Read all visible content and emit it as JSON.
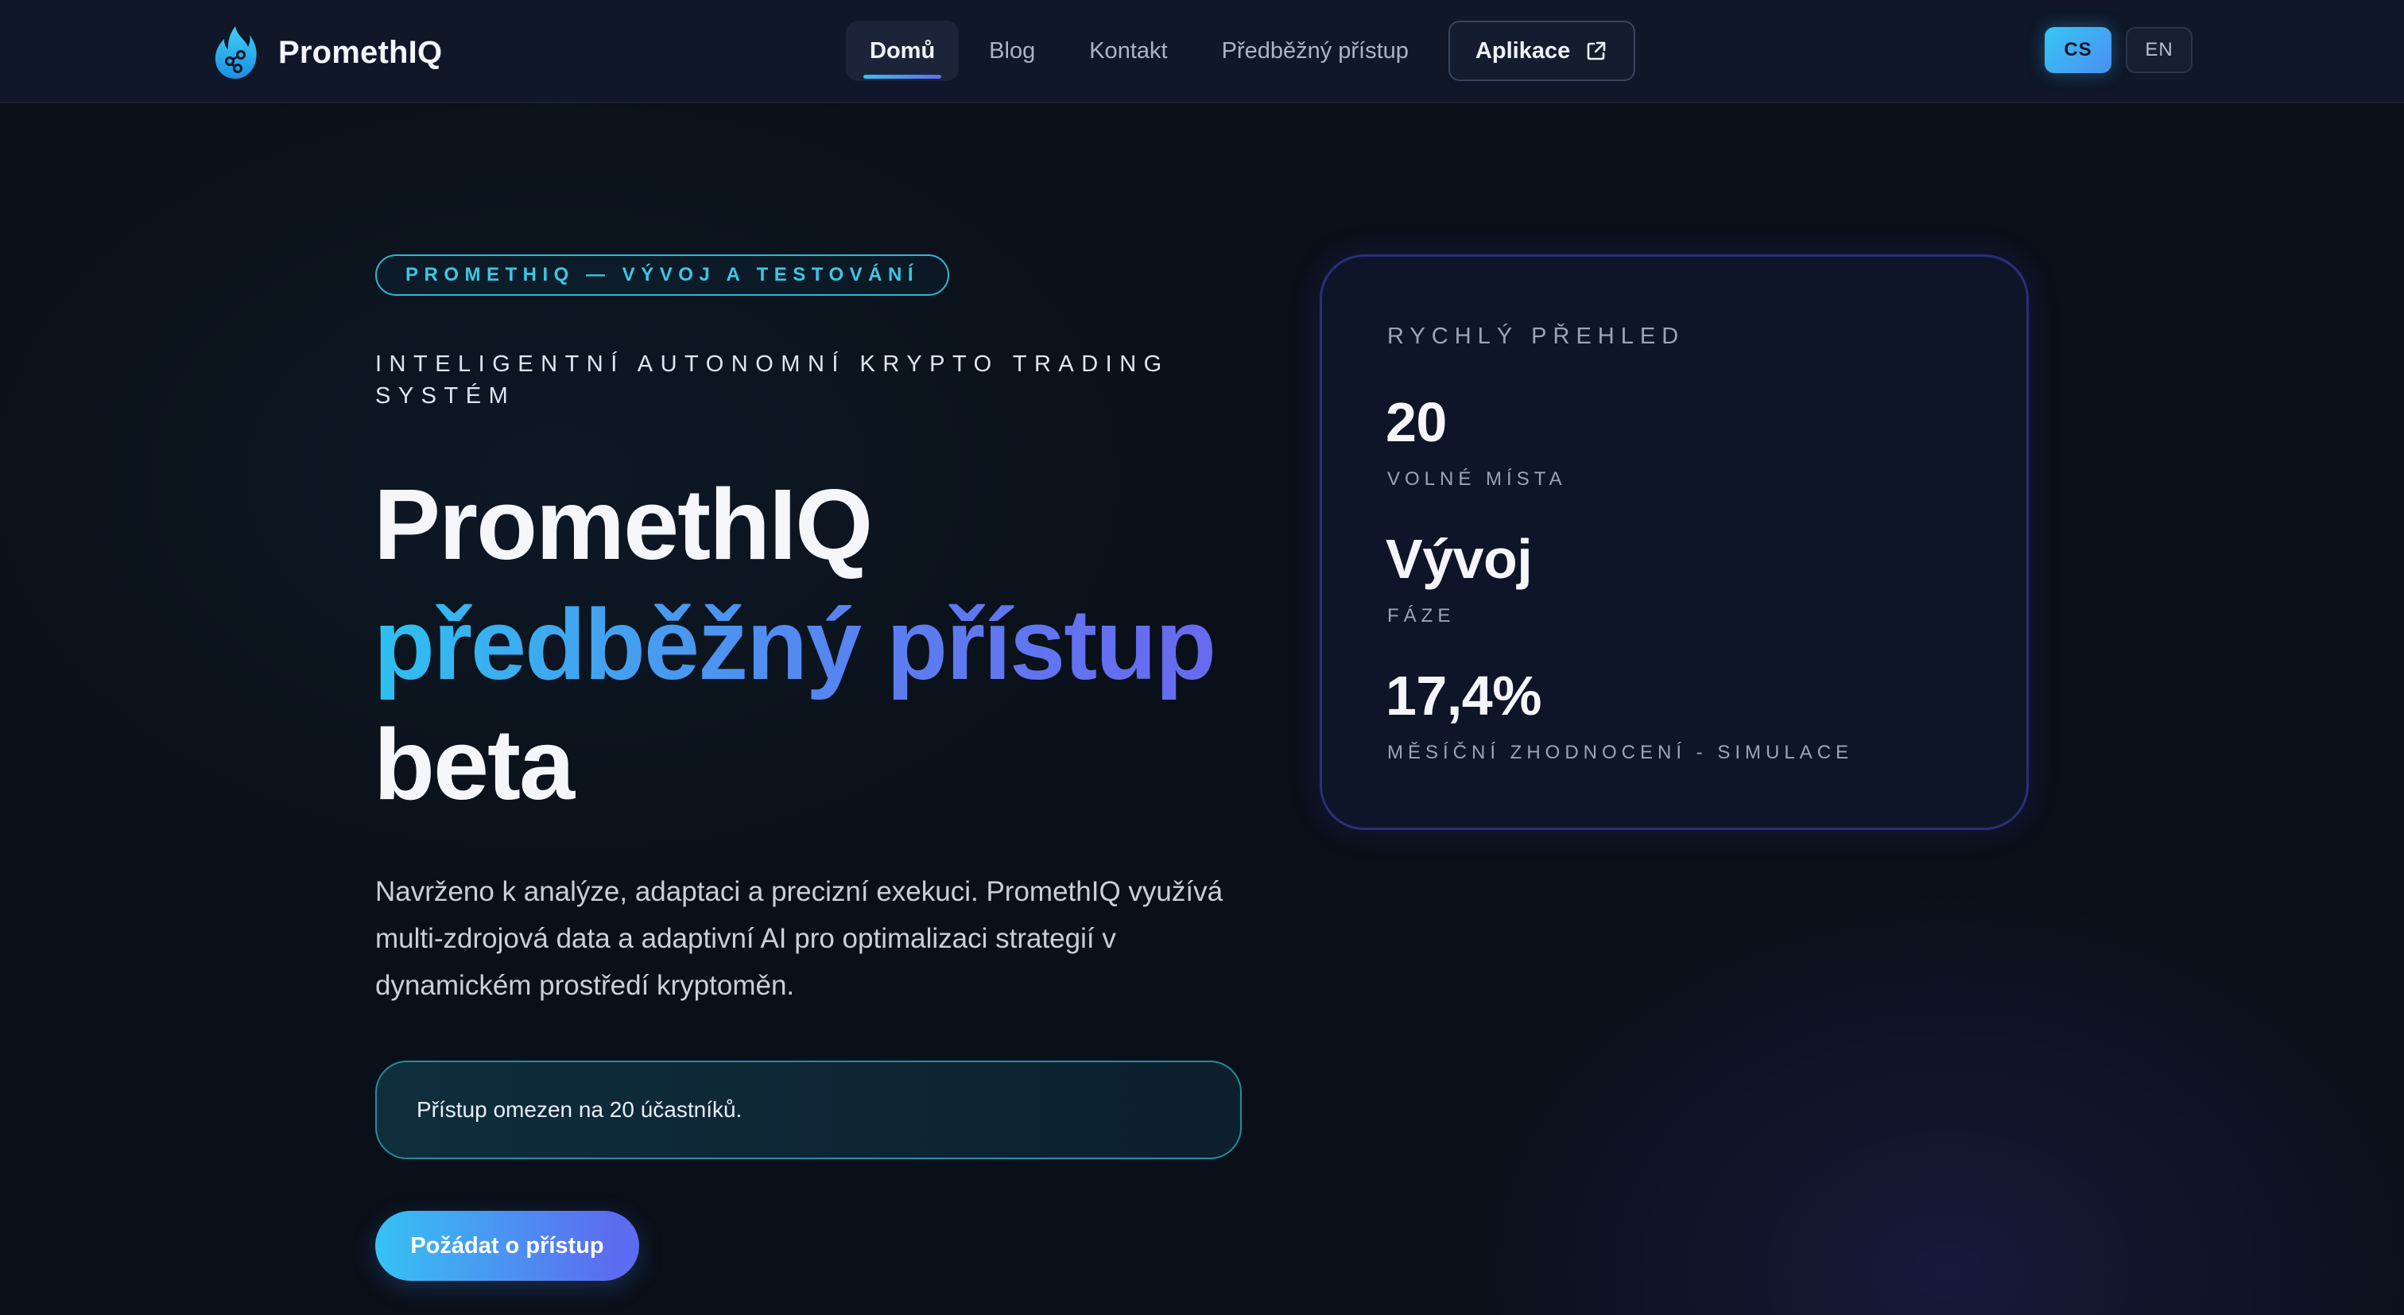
{
  "nav": {
    "brand": "PromethIQ",
    "items": [
      {
        "label": "Domů",
        "active": true
      },
      {
        "label": "Blog",
        "active": false
      },
      {
        "label": "Kontakt",
        "active": false
      },
      {
        "label": "Předběžný přístup",
        "active": false
      }
    ],
    "app_button": {
      "label": "Aplikace",
      "icon": "external-link-icon"
    },
    "languages": [
      {
        "code": "CS",
        "active": true
      },
      {
        "code": "EN",
        "active": false
      }
    ]
  },
  "hero": {
    "badge": "PROMETHIQ — VÝVOJ A TESTOVÁNÍ",
    "eyebrow": "INTELIGENTNÍ AUTONOMNÍ KRYPTO TRADING SYSTÉM",
    "headline": {
      "line1": "PromethIQ",
      "line2": "předběžný přístup",
      "line3": "beta"
    },
    "description": "Navrženo k analýze, adaptaci a precizní exekuci. PromethIQ využívá multi-zdrojová data a adaptivní AI pro optimalizaci strategií v dynamickém prostředí kryptoměn.",
    "notice": "Přístup omezen na 20 účastníků.",
    "cta": "Požádat o přístup"
  },
  "overview": {
    "title": "RYCHLÝ PŘEHLED",
    "stats": [
      {
        "value": "20",
        "label": "VOLNÉ MÍSTA"
      },
      {
        "value": "Vývoj",
        "label": "FÁZE"
      },
      {
        "value": "17,4%",
        "label": "MĚSÍČNÍ ZHODNOCENÍ - SIMULACE"
      }
    ]
  },
  "colors": {
    "background": "#0a1019",
    "accent_cyan": "#36c2f3",
    "accent_violet": "#5c6cf0",
    "card_border": "#2a2f7a"
  }
}
